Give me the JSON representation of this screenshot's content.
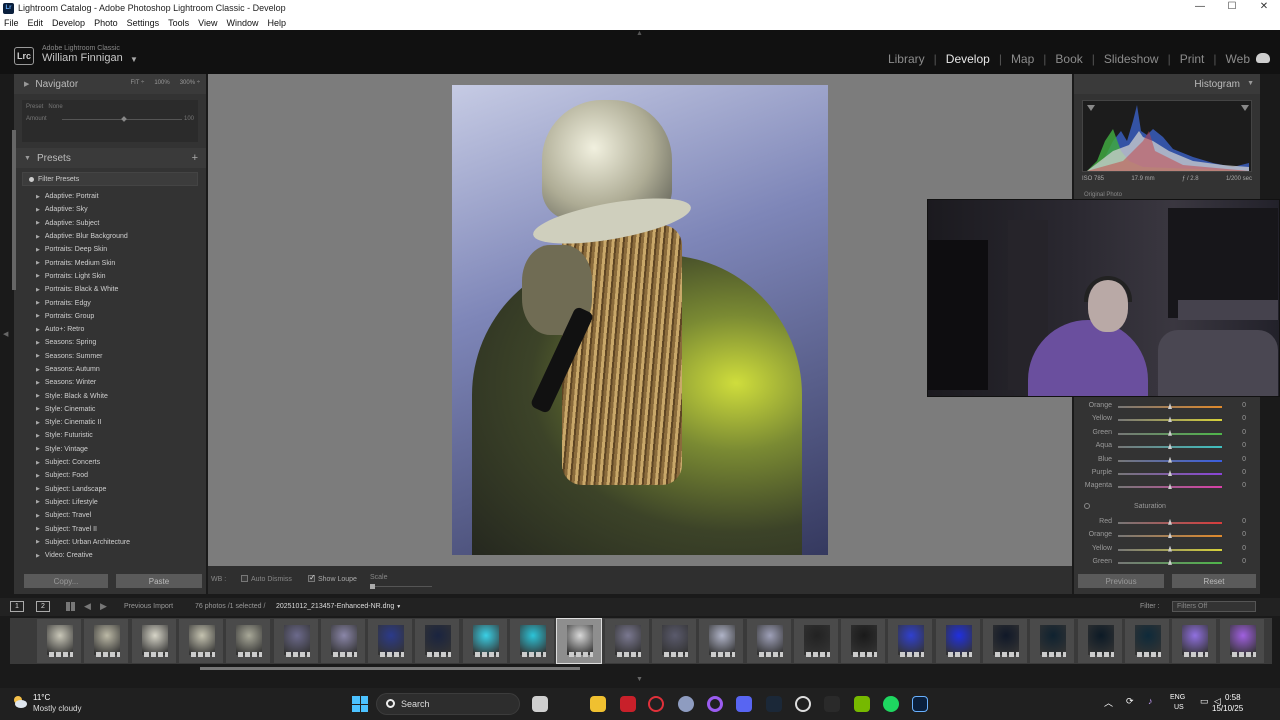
{
  "window": {
    "title": "Lightroom Catalog - Adobe Photoshop Lightroom Classic - Develop",
    "controls": [
      "—",
      "☐",
      "✕"
    ]
  },
  "menu": [
    "File",
    "Edit",
    "Develop",
    "Photo",
    "Settings",
    "Tools",
    "View",
    "Window",
    "Help"
  ],
  "identity": {
    "logo": "Lrc",
    "product": "Adobe Lightroom Classic",
    "user": "William Finnigan",
    "caret": "▼"
  },
  "modules": [
    "Library",
    "Develop",
    "Map",
    "Book",
    "Slideshow",
    "Print",
    "Web"
  ],
  "active_module": "Develop",
  "navigator": {
    "title": "Navigator",
    "zoom": [
      "FIT ÷",
      "100%",
      "300% ÷"
    ],
    "preset_label": "Preset",
    "preset_value": "None",
    "amount_label": "Amount",
    "amount_value": "100"
  },
  "presets": {
    "title": "Presets",
    "add": "+",
    "filter": "Filter Presets",
    "items": [
      "Adaptive: Portrait",
      "Adaptive: Sky",
      "Adaptive: Subject",
      "Adaptive: Blur Background",
      "Portraits: Deep Skin",
      "Portraits: Medium Skin",
      "Portraits: Light Skin",
      "Portraits: Black & White",
      "Portraits: Edgy",
      "Portraits: Group",
      "Auto+: Retro",
      "Seasons: Spring",
      "Seasons: Summer",
      "Seasons: Autumn",
      "Seasons: Winter",
      "Style: Black & White",
      "Style: Cinematic",
      "Style: Cinematic II",
      "Style: Futuristic",
      "Style: Vintage",
      "Subject: Concerts",
      "Subject: Food",
      "Subject: Landscape",
      "Subject: Lifestyle",
      "Subject: Travel",
      "Subject: Travel II",
      "Subject: Urban Architecture",
      "Video: Creative"
    ]
  },
  "left_buttons": {
    "copy": "Copy...",
    "paste": "Paste"
  },
  "toolbar": {
    "wb": "WB :",
    "auto_dismiss": "Auto Dismiss",
    "show_loupe": "Show Loupe",
    "scale": "Scale"
  },
  "histogram": {
    "title": "Histogram",
    "iso": "ISO 785",
    "focal": "17.9 mm",
    "aperture": "ƒ / 2.8",
    "shutter": "1/200 sec",
    "original_photo": "Original Photo"
  },
  "hsl": {
    "hue_rows": [
      {
        "name": "Orange",
        "value": "0",
        "color": "#e08a2c"
      },
      {
        "name": "Yellow",
        "value": "0",
        "color": "#d8d23a"
      },
      {
        "name": "Green",
        "value": "0",
        "color": "#4fb64a"
      },
      {
        "name": "Aqua",
        "value": "0",
        "color": "#3fc0c0"
      },
      {
        "name": "Blue",
        "value": "0",
        "color": "#3a5ee0"
      },
      {
        "name": "Purple",
        "value": "0",
        "color": "#8a44d8"
      },
      {
        "name": "Magenta",
        "value": "0",
        "color": "#d840a8"
      }
    ],
    "saturation_label": "Saturation",
    "sat_rows": [
      {
        "name": "Red",
        "value": "0",
        "color": "#d83c3c"
      },
      {
        "name": "Orange",
        "value": "0",
        "color": "#e08a2c"
      },
      {
        "name": "Yellow",
        "value": "0",
        "color": "#d8d23a"
      },
      {
        "name": "Green",
        "value": "0",
        "color": "#4fb64a"
      }
    ]
  },
  "right_buttons": {
    "previous": "Previous",
    "reset": "Reset"
  },
  "filmbar": {
    "screen1": "1",
    "screen2": "2",
    "source": "Previous Import",
    "count": "76 photos /1 selected /",
    "filename": "20251012_213457-Enhanced-NR.dng",
    "filename_caret": "▼",
    "filter_label": "Filter :",
    "filter_value": "Filters Off"
  },
  "taskbar": {
    "temp": "11°C",
    "weather": "Mostly cloudy",
    "search": "Search",
    "lang1": "ENG",
    "lang2": "US",
    "time": "0:58",
    "date": "15/10/25"
  }
}
